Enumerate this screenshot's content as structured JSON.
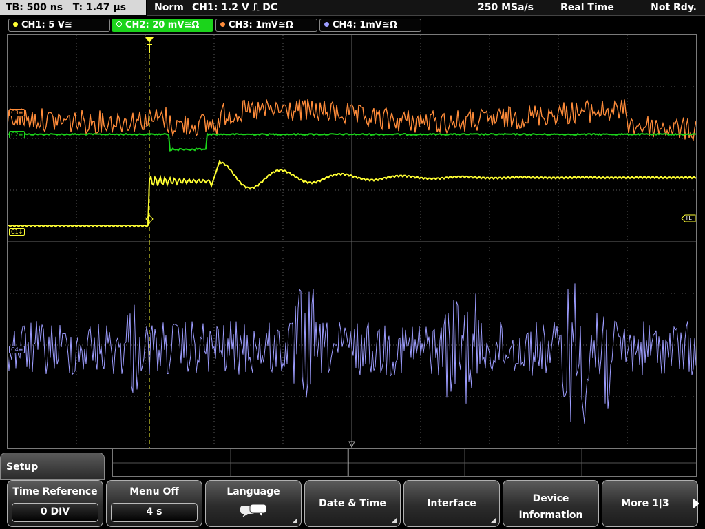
{
  "status": {
    "timebase": "TB: 500 ns   T: 1.47 µs",
    "mode": "Norm",
    "trigger": "CH1: 1.2 V ⎍ DC",
    "sample_rate": "250 MSa/s",
    "acquisition": "Real Time",
    "state": "Not Rdy."
  },
  "channels": [
    {
      "label": "CH1: 5 V≅",
      "color": "#ffff33"
    },
    {
      "label": "CH2: 20 mV≅Ω",
      "color": "#1bd41b",
      "active": true
    },
    {
      "label": "CH3: 1mV≅Ω",
      "color": "#ff8c3a"
    },
    {
      "label": "CH4: 1mV≅Ω",
      "color": "#9d9dff"
    }
  ],
  "markers": {
    "ch1": "C1↓",
    "ch2": "C2≡",
    "ch3": "C3≡",
    "ch4": "C4≡",
    "trigger_level": "TL"
  },
  "menu": {
    "title": "Setup",
    "time_reference": {
      "label": "Time Reference",
      "value": "0 DIV"
    },
    "menu_off": {
      "label": "Menu Off",
      "value": "4 s"
    },
    "language": {
      "label": "Language",
      "icon": "speech-bubbles-icon"
    },
    "date_time": {
      "label": "Date & Time"
    },
    "interface": {
      "label": "Interface"
    },
    "device_information": {
      "line1": "Device",
      "line2": "Information"
    },
    "more": {
      "label": "More 1|3",
      "icon": "triangle-right-icon"
    }
  },
  "colors": {
    "ch1": "#ffff33",
    "ch2": "#1bd41b",
    "ch3": "#ff8c3a",
    "ch4": "#9d9dff",
    "grid": "#5a5a5a",
    "trigger_line": "#ffff33"
  }
}
